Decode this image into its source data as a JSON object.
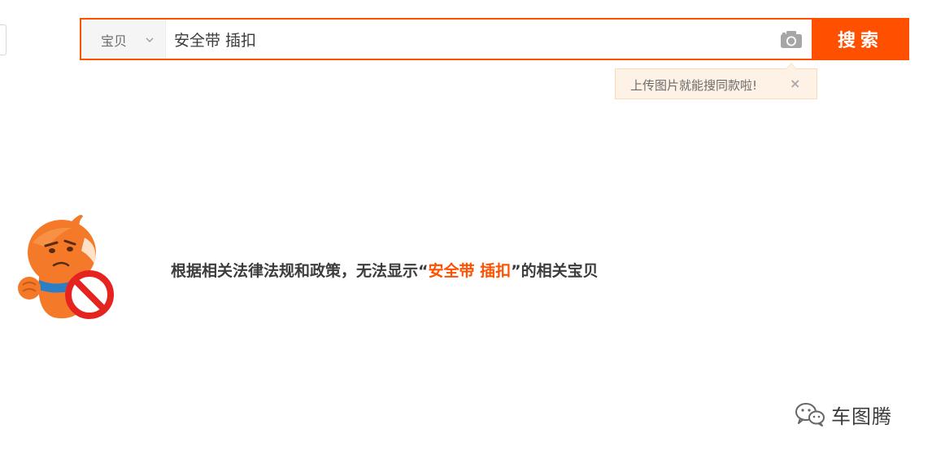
{
  "search": {
    "scope_label": "宝贝",
    "query": "安全带 插扣",
    "button_label": "搜索"
  },
  "tooltip": {
    "text": "上传图片就能搜同款啦!",
    "close_glyph": "×"
  },
  "notice": {
    "prefix": "根据相关法律法规和政策，无法显示“",
    "keyword": "安全带 插扣",
    "suffix": "”的相关宝贝"
  },
  "watermark": {
    "text": "车图腾"
  },
  "icons": {
    "scope": "chevron-down-icon",
    "camera": "camera-icon",
    "close": "close-icon",
    "mascot": "prohibited-mascot-icon",
    "watermark": "wechat-icon"
  },
  "colors": {
    "accent": "#ff5000",
    "tooltip_bg": "#fef2e6",
    "tooltip_border": "#fbdcb6",
    "text": "#3c3c3c"
  }
}
